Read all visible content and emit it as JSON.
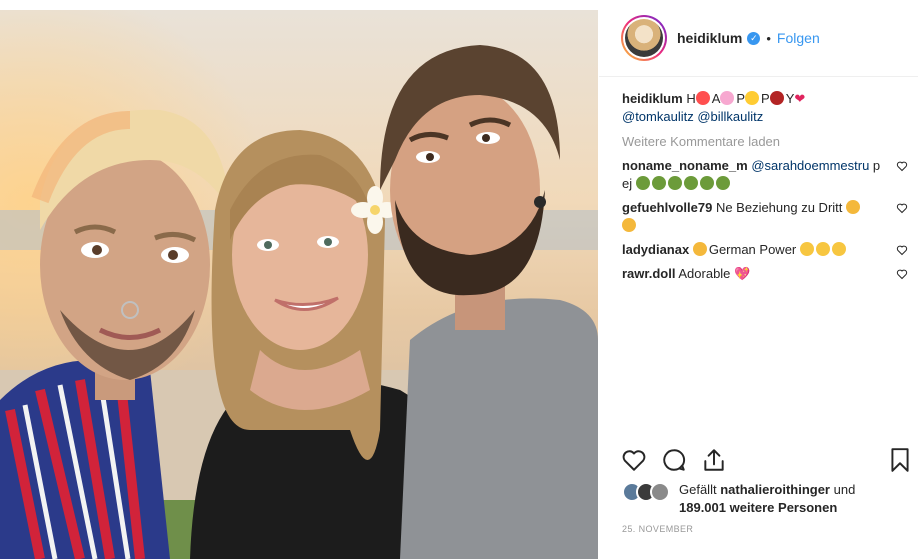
{
  "header": {
    "username": "heidiklum",
    "verified_icon": "verified-check-icon",
    "separator": "•",
    "follow_label": "Folgen"
  },
  "caption": {
    "username": "heidiklum",
    "text_h": "H",
    "text_a": "A",
    "text_p1": "P",
    "text_p2": "P",
    "text_y": "Y",
    "mention1": "@tomkaulitz",
    "mention2": "@billkaulitz"
  },
  "load_more": "Weitere Kommentare laden",
  "comments": [
    {
      "username": "noname_noname_m",
      "mention": "@sarahdoemmestru",
      "text": "p ej"
    },
    {
      "username": "gefuehlvolle79",
      "text": "Ne Beziehung zu Dritt"
    },
    {
      "username": "ladydianax",
      "text": "German Power"
    },
    {
      "username": "rawr.doll",
      "text": "Adorable"
    }
  ],
  "actions": {
    "like_icon": "heart-icon",
    "comment_icon": "comment-icon",
    "share_icon": "share-icon",
    "save_icon": "bookmark-icon"
  },
  "likes": {
    "prefix": "Gefällt",
    "user": "nathalieroithinger",
    "suffix": "und",
    "count_text": "189.001 weitere Personen"
  },
  "date": "25. NOVEMBER",
  "colors": {
    "accent": "#3897f0",
    "text": "#262626",
    "muted": "#999999",
    "mention": "#003569"
  }
}
